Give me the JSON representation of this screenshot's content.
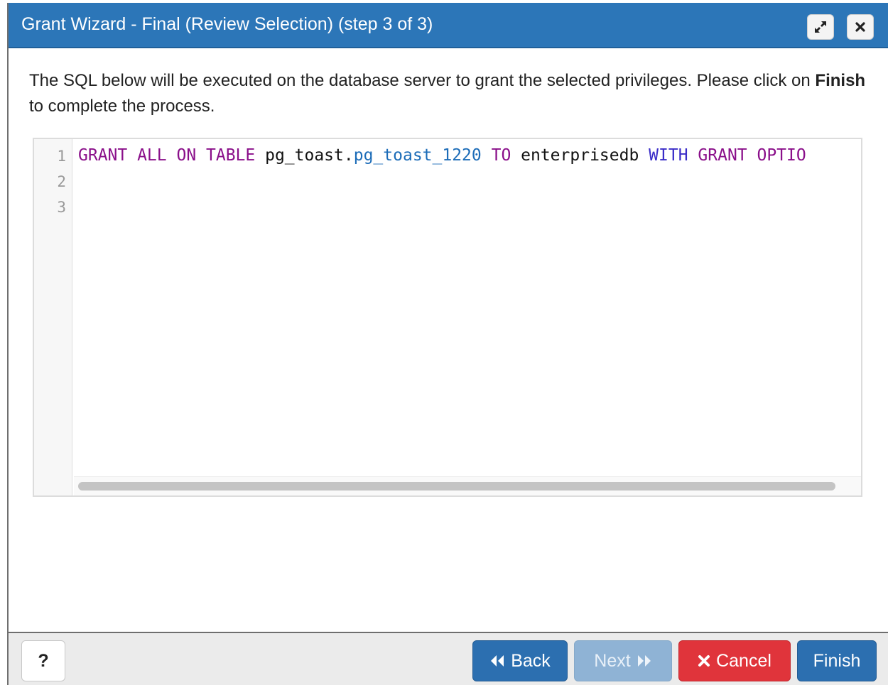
{
  "dialog": {
    "title": "Grant Wizard - Final (Review Selection) (step 3 of 3)",
    "maximize_icon": "maximize-icon",
    "close_icon": "close-icon",
    "title_color": "#2c76b8"
  },
  "description": {
    "text_before": "The SQL below will be executed on the database server to grant the selected privileges. Please click on ",
    "bold": "Finish",
    "text_after": " to complete the process."
  },
  "editor": {
    "line_numbers": [
      "1",
      "2",
      "3"
    ],
    "line1": {
      "t1": "GRANT ALL ON TABLE",
      "t2": " pg_toast.",
      "t3": "pg_toast_1220",
      "t4": " TO",
      "t5": " enterprisedb ",
      "t6": "WITH",
      "t7": " GRANT OPTIO"
    }
  },
  "footer": {
    "help_label": "?",
    "back_label": "Back",
    "next_label": "Next",
    "cancel_label": "Cancel",
    "finish_label": "Finish",
    "colors": {
      "primary": "#2c6fb0",
      "disabled": "#8fb3d5",
      "danger": "#e0343b"
    }
  }
}
